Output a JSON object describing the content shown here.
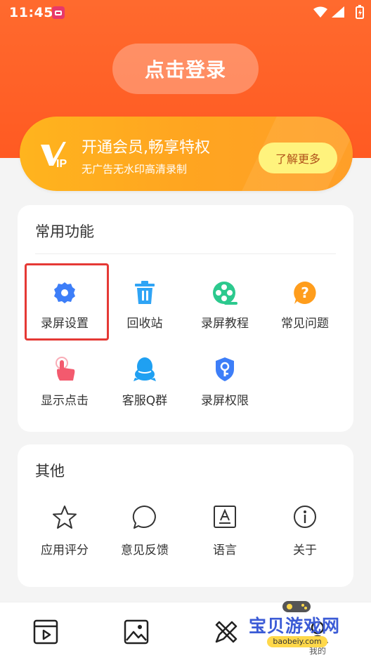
{
  "status_bar": {
    "time": "11:45"
  },
  "header": {
    "login_label": "点击登录"
  },
  "vip": {
    "logo_text": "VIP",
    "title": "开通会员,畅享特权",
    "subtitle": "无广告无水印高清录制",
    "button_label": "了解更多"
  },
  "common": {
    "title": "常用功能",
    "items": [
      {
        "label": "录屏设置",
        "icon": "gear-icon",
        "color": "#3d7ef8"
      },
      {
        "label": "回收站",
        "icon": "trash-icon",
        "color": "#2fa4f5"
      },
      {
        "label": "录屏教程",
        "icon": "film-reel-icon",
        "color": "#2cc98e"
      },
      {
        "label": "常见问题",
        "icon": "question-bubble-icon",
        "color": "#ff9d1c"
      },
      {
        "label": "显示点击",
        "icon": "tap-hand-icon",
        "color": "#f35a6e"
      },
      {
        "label": "客服Q群",
        "icon": "qq-penguin-icon",
        "color": "#1fa0f2"
      },
      {
        "label": "录屏权限",
        "icon": "shield-key-icon",
        "color": "#3d7ef8"
      }
    ]
  },
  "other": {
    "title": "其他",
    "items": [
      {
        "label": "应用评分",
        "icon": "star-icon"
      },
      {
        "label": "意见反馈",
        "icon": "chat-bubble-icon"
      },
      {
        "label": "语言",
        "icon": "language-icon"
      },
      {
        "label": "关于",
        "icon": "info-icon"
      }
    ]
  },
  "bottom_nav": {
    "items": [
      {
        "icon": "video-icon"
      },
      {
        "icon": "image-icon"
      },
      {
        "icon": "tools-icon"
      },
      {
        "label": "我的",
        "icon": "profile-icon"
      }
    ]
  },
  "watermark": {
    "text": "宝贝游戏网",
    "url": "baobeiy.com"
  }
}
